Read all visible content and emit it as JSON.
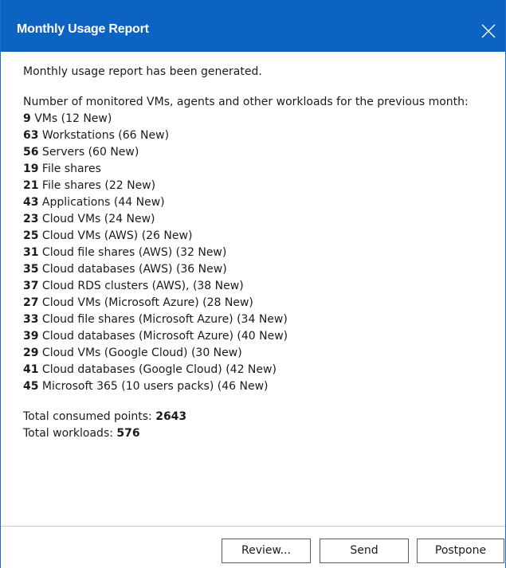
{
  "dialog": {
    "title": "Monthly Usage Report",
    "close_icon": "close-icon"
  },
  "message": {
    "intro": "Monthly usage report has been generated.",
    "heading": "Number of monitored VMs, agents and other workloads for the previous month:",
    "items": [
      {
        "count": "9",
        "text": " VMs (12 New)"
      },
      {
        "count": "63",
        "text": " Workstations (66 New)"
      },
      {
        "count": "56",
        "text": " Servers (60 New)"
      },
      {
        "count": "19",
        "text": " File shares"
      },
      {
        "count": "21",
        "text": " File shares (22 New)"
      },
      {
        "count": "43",
        "text": " Applications (44 New)"
      },
      {
        "count": "23",
        "text": " Cloud VMs (24 New)"
      },
      {
        "count": "25",
        "text": " Cloud VMs (AWS) (26 New)"
      },
      {
        "count": "31",
        "text": " Cloud file shares (AWS) (32 New)"
      },
      {
        "count": "35",
        "text": " Cloud databases (AWS) (36 New)"
      },
      {
        "count": "37",
        "text": " Cloud RDS clusters (AWS), (38 New)"
      },
      {
        "count": "27",
        "text": " Cloud VMs (Microsoft Azure) (28 New)"
      },
      {
        "count": "33",
        "text": " Cloud file shares (Microsoft Azure) (34 New)"
      },
      {
        "count": "39",
        "text": " Cloud databases (Microsoft Azure) (40 New)"
      },
      {
        "count": "29",
        "text": " Cloud VMs (Google Cloud) (30 New)"
      },
      {
        "count": "41",
        "text": " Cloud databases (Google Cloud) (42 New)"
      },
      {
        "count": "45",
        "text": " Microsoft 365 (10 users packs) (46 New)"
      }
    ],
    "total_points_label": "Total consumed points: ",
    "total_points_value": "2643",
    "total_workloads_label": "Total workloads: ",
    "total_workloads_value": "576"
  },
  "buttons": {
    "review": "Review...",
    "send": "Send",
    "postpone": "Postpone"
  },
  "colors": {
    "titlebar": "#0c63c2",
    "title_text": "#ffffff",
    "border": "#1d6fc6"
  }
}
